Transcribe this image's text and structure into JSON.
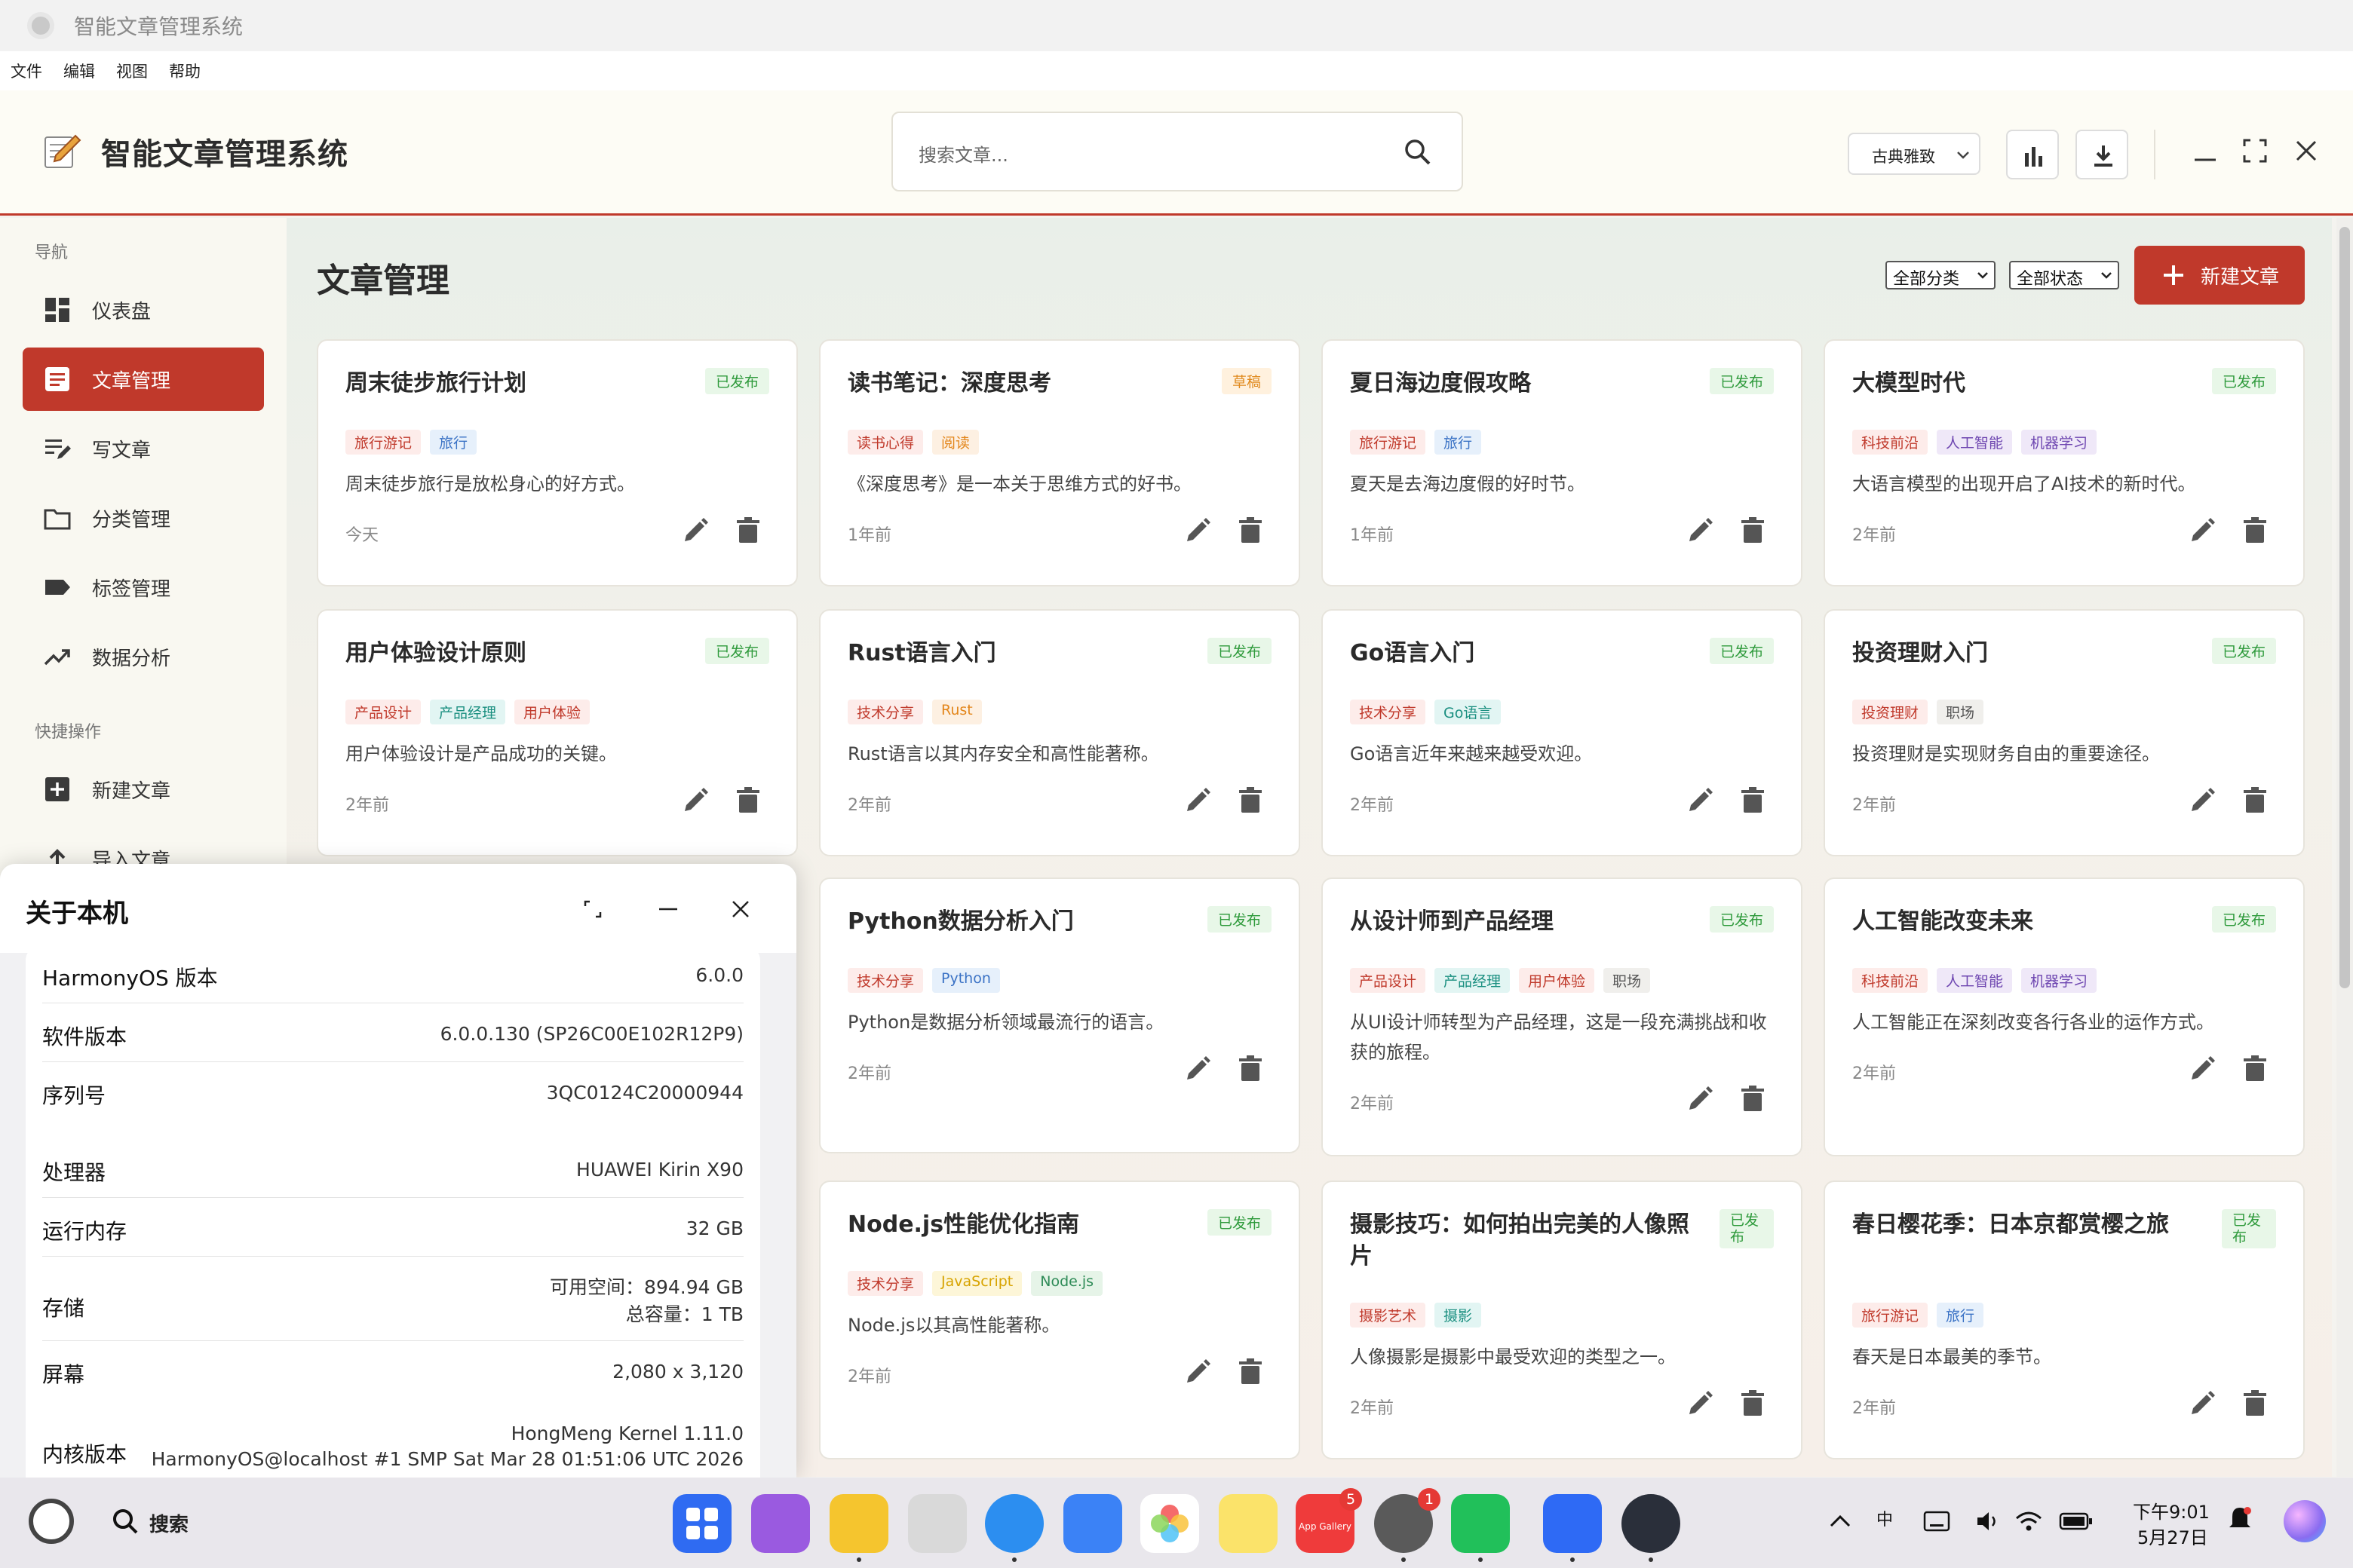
{
  "window": {
    "title": "智能文章管理系统"
  },
  "menu": [
    "文件",
    "编辑",
    "视图",
    "帮助"
  ],
  "header": {
    "brand": "智能文章管理系统",
    "search_placeholder": "搜索文章...",
    "theme": "古典雅致"
  },
  "sidebar": {
    "nav_label": "导航",
    "quick_label": "快捷操作",
    "items": [
      "仪表盘",
      "文章管理",
      "写文章",
      "分类管理",
      "标签管理",
      "数据分析"
    ],
    "quick": [
      "新建文章",
      "导入文章"
    ]
  },
  "main": {
    "title": "文章管理",
    "filter_category": "全部分类",
    "filter_status": "全部状态",
    "new_button": "新建文章"
  },
  "articles": [
    {
      "title": "周末徒步旅行计划",
      "status": "已发布",
      "tags": [
        "旅行游记",
        "旅行"
      ],
      "summary": "周末徒步旅行是放松身心的好方式。",
      "time": "今天"
    },
    {
      "title": "读书笔记：深度思考",
      "status": "草稿",
      "tags": [
        "读书心得",
        "阅读"
      ],
      "summary": "《深度思考》是一本关于思维方式的好书。",
      "time": "1年前"
    },
    {
      "title": "夏日海边度假攻略",
      "status": "已发布",
      "tags": [
        "旅行游记",
        "旅行"
      ],
      "summary": "夏天是去海边度假的好时节。",
      "time": "1年前"
    },
    {
      "title": "大模型时代",
      "status": "已发布",
      "tags": [
        "科技前沿",
        "人工智能",
        "机器学习"
      ],
      "summary": "大语言模型的出现开启了AI技术的新时代。",
      "time": "2年前"
    },
    {
      "title": "用户体验设计原则",
      "status": "已发布",
      "tags": [
        "产品设计",
        "产品经理",
        "用户体验"
      ],
      "summary": "用户体验设计是产品成功的关键。",
      "time": "2年前"
    },
    {
      "title": "Rust语言入门",
      "status": "已发布",
      "tags": [
        "技术分享",
        "Rust"
      ],
      "summary": "Rust语言以其内存安全和高性能著称。",
      "time": "2年前"
    },
    {
      "title": "Go语言入门",
      "status": "已发布",
      "tags": [
        "技术分享",
        "Go语言"
      ],
      "summary": "Go语言近年来越来越受欢迎。",
      "time": "2年前"
    },
    {
      "title": "投资理财入门",
      "status": "已发布",
      "tags": [
        "投资理财",
        "职场"
      ],
      "summary": "投资理财是实现财务自由的重要途径。",
      "time": "2年前"
    },
    {
      "title": "Python数据分析入门",
      "status": "已发布",
      "tags": [
        "技术分享",
        "Python"
      ],
      "summary": "Python是数据分析领域最流行的语言。",
      "time": "2年前"
    },
    {
      "title": "从设计师到产品经理",
      "status": "已发布",
      "tags": [
        "产品设计",
        "产品经理",
        "用户体验",
        "职场"
      ],
      "summary": "从UI设计师转型为产品经理，这是一段充满挑战和收获的旅程。",
      "time": "2年前"
    },
    {
      "title": "人工智能改变未来",
      "status": "已发布",
      "tags": [
        "科技前沿",
        "人工智能",
        "机器学习"
      ],
      "summary": "人工智能正在深刻改变各行各业的运作方式。",
      "time": "2年前"
    },
    {
      "title": "Node.js性能优化指南",
      "status": "已发布",
      "tags": [
        "技术分享",
        "JavaScript",
        "Node.js"
      ],
      "summary": "Node.js以其高性能著称。",
      "time": "2年前"
    },
    {
      "title": "摄影技巧：如何拍出完美的人像照片",
      "status": "已发布",
      "tags": [
        "摄影艺术",
        "摄影"
      ],
      "summary": "人像摄影是摄影中最受欢迎的类型之一。",
      "time": "2年前"
    },
    {
      "title": "春日樱花季：日本京都赏樱之旅",
      "status": "已发布",
      "tags": [
        "旅行游记",
        "旅行"
      ],
      "summary": "春天是日本最美的季节。",
      "time": "2年前"
    }
  ],
  "about": {
    "title": "关于本机",
    "rows": [
      {
        "k": "HarmonyOS 版本",
        "v": "6.0.0"
      },
      {
        "k": "软件版本",
        "v": "6.0.0.130 (SP26C00E102R12P9)"
      },
      {
        "k": "序列号",
        "v": "3QC0124C20000944"
      },
      {
        "k": "处理器",
        "v": "HUAWEI Kirin X90"
      },
      {
        "k": "运行内存",
        "v": "32 GB"
      },
      {
        "k": "存储",
        "v": "可用空间：894.94 GB",
        "v2": "总容量：1 TB"
      },
      {
        "k": "屏幕",
        "v": "2,080 x 3,120"
      },
      {
        "k": "内核版本",
        "v": "HongMeng Kernel 1.11.0",
        "v2": "HarmonyOS@localhost #1 SMP Sat Mar 28 01:51:06 UTC 2026"
      }
    ]
  },
  "taskbar": {
    "search": "搜索",
    "time": "下午9:01",
    "date": "5月27日",
    "ime": "中",
    "badges": {
      "appgallery": "5",
      "settings": "1"
    },
    "appgallery_label": "App Gallery"
  }
}
